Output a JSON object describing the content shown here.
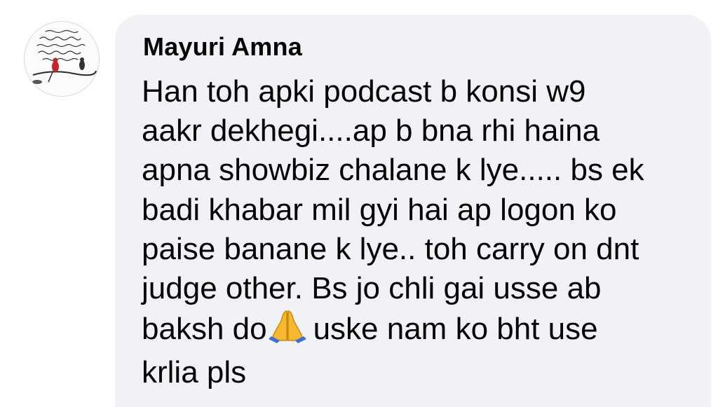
{
  "comment": {
    "author": "Mayuri Amna",
    "avatar_icon": "profile-photo-icon",
    "message_lines": [
      "Han toh apki podcast b konsi w9",
      "aakr dekhegi....ap b bna rhi haina",
      "apna showbiz chalane k lye..... bs ek",
      "badi khabar mil gyi hai ap logon ko",
      "paise banane k lye.. toh carry on dnt",
      "judge other. Bs jo chli gai usse ab"
    ],
    "message_line_7_before_emoji": "baksh do",
    "emoji": "folded-hands-emoji",
    "message_line_7_after_emoji": "uske nam ko bht use",
    "message_line_8": "krlia pls",
    "bubble_color": "#f0f2f5",
    "text_color": "#050505"
  }
}
